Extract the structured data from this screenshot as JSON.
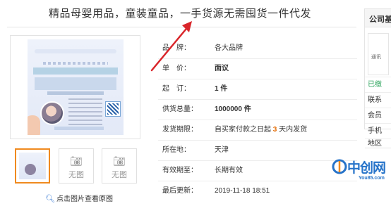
{
  "title": "精品母婴用品，童装童品，一手货源无需囤货一件代发",
  "product_image": {
    "thumbs": [
      {
        "label": ""
      },
      {
        "label": "无图"
      },
      {
        "label": "无图"
      }
    ]
  },
  "zoom_link": "点击图片查看原图",
  "details": [
    {
      "label": "品　牌：",
      "value": "各大品牌"
    },
    {
      "label": "单　价：",
      "value": "面议"
    },
    {
      "label": "起　订：",
      "value": "1 件"
    },
    {
      "label": "供货总量：",
      "value": "1000000 件"
    },
    {
      "label": "发货期限：",
      "value_prefix": "自买家付款之日起",
      "value_num": "3",
      "value_suffix": "天内发货"
    },
    {
      "label": "所在地：",
      "value": "天津"
    },
    {
      "label": "有效期至：",
      "value": "长期有效"
    },
    {
      "label": "最后更新：",
      "value": "2019-11-18 18:51"
    }
  ],
  "sidebar": {
    "title": "公司基",
    "box_label": "通讯",
    "items": [
      "已缴",
      "联系",
      "会员",
      "手机",
      "地区"
    ]
  },
  "watermark": {
    "text": "中创网",
    "sub": "You85.com"
  },
  "colors": {
    "accent": "#e4393c",
    "orange": "#e46a00",
    "thumb_border": "#f08a1f",
    "arrow": "#d9252a",
    "watermark": "#2673c9"
  },
  "icons": [
    "camera-icon",
    "magnifier-icon",
    "red-arrow-annotation"
  ]
}
